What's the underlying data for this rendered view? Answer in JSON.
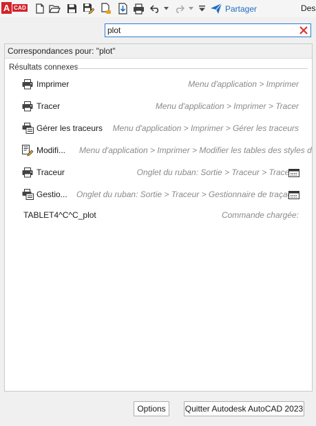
{
  "toolbar": {
    "logo_letter": "A",
    "logo_text": "CAD",
    "share_label": "Partager",
    "doc_title": "Dess",
    "icons": [
      "new-icon",
      "open-icon",
      "save-icon",
      "save-as-icon",
      "open-from-web-icon",
      "save-to-web-icon",
      "plot-icon",
      "undo-icon",
      "undo-dropdown-icon",
      "redo-icon",
      "redo-dropdown-icon",
      "customize-dropdown-icon",
      "share-icon"
    ]
  },
  "search": {
    "value": "plot"
  },
  "results": {
    "matches_label": "Correspondances pour: \"plot\"",
    "section_title": "Résultats connexes",
    "items": [
      {
        "name": "Imprimer",
        "path": "Menu d'application > Imprimer",
        "icon": "printer-icon"
      },
      {
        "name": "Tracer",
        "path": "Menu d'application > Imprimer > Tracer",
        "icon": "printer-icon"
      },
      {
        "name": "Gérer les traceurs",
        "path": "Menu d'application > Imprimer > Gérer les traceurs",
        "icon": "plotter-manager-icon"
      },
      {
        "name": "Modifi...",
        "path": "Menu d'application > Imprimer > Modifier les tables des styles de",
        "icon": "plot-style-icon"
      },
      {
        "name": "Traceur",
        "path": "Onglet du ruban: Sortie > Traceur > Traceur",
        "icon": "printer-icon"
      },
      {
        "name": "Gestio...",
        "path": "Onglet du ruban: Sortie > Traceur > Gestionnaire de traçage",
        "icon": "plotter-manager-icon"
      },
      {
        "name": "TABLET4^C^C_plot",
        "path": "Commande chargée:",
        "icon": ""
      }
    ]
  },
  "buttons": {
    "options": "Options",
    "quit": "Quitter Autodesk AutoCAD 2023"
  },
  "colors": {
    "accent": "#2b79d6",
    "share": "#1f6fbf",
    "logo": "#d2232a",
    "clear": "#e03131"
  }
}
